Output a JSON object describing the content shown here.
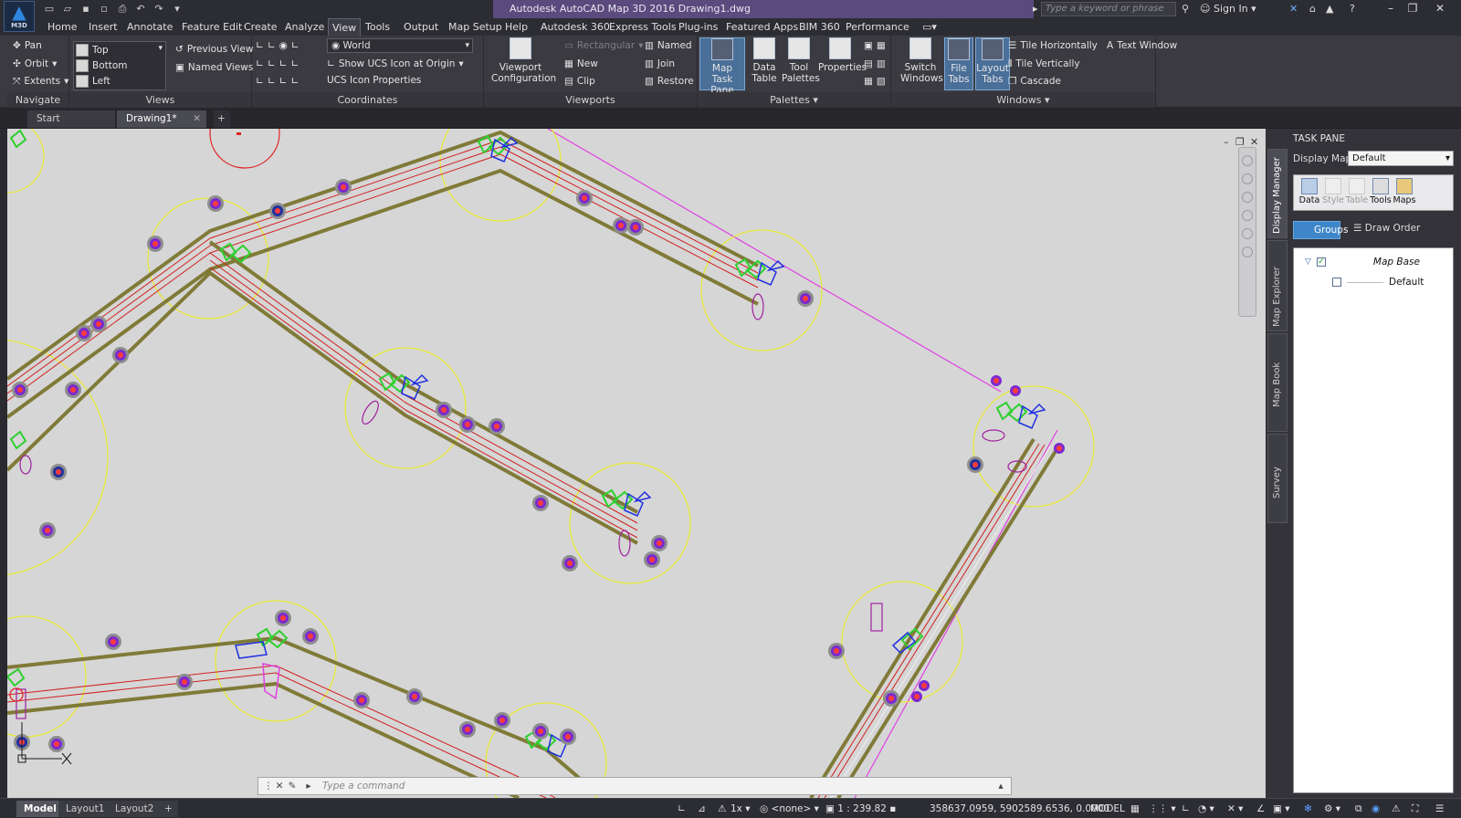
{
  "app": {
    "title": "Autodesk AutoCAD Map 3D 2016    Drawing1.dwg",
    "logo_text": "M3D",
    "search_placeholder": "Type a keyword or phrase",
    "sign_in": "Sign In"
  },
  "menu": [
    "Home",
    "Insert",
    "Annotate",
    "Feature Edit",
    "Create",
    "Analyze",
    "View",
    "Tools",
    "Output",
    "Map Setup",
    "Help",
    "Autodesk 360",
    "Express Tools",
    "Plug-ins",
    "Featured Apps",
    "BIM 360",
    "Performance"
  ],
  "menu_active": "View",
  "ribbon": {
    "navigate": {
      "title": "Navigate",
      "pan": "Pan",
      "orbit": "Orbit",
      "extents": "Extents"
    },
    "views": {
      "title": "Views",
      "top": "Top",
      "bottom": "Bottom",
      "left": "Left",
      "previous": "Previous View",
      "named": "Named Views"
    },
    "coordinates": {
      "title": "Coordinates",
      "world": "World",
      "show_ucs": "Show UCS Icon at Origin",
      "ucs_props": "UCS Icon Properties"
    },
    "viewports": {
      "title": "Viewports",
      "config": "Viewport Configuration",
      "rectangular": "Rectangular",
      "named": "Named",
      "new": "New",
      "join": "Join",
      "clip": "Clip",
      "restore": "Restore"
    },
    "palettes": {
      "title": "Palettes",
      "map_task_pane": "Map Task Pane",
      "data_table": "Data Table",
      "tool_palettes": "Tool Palettes",
      "properties": "Properties"
    },
    "windows": {
      "title": "Windows",
      "switch": "Switch Windows",
      "file_tabs": "File Tabs",
      "layout_tabs": "Layout Tabs",
      "tile_h": "Tile Horizontally",
      "tile_v": "Tile Vertically",
      "cascade": "Cascade",
      "text_window": "Text Window"
    }
  },
  "doc_tabs": [
    {
      "label": "Start"
    },
    {
      "label": "Drawing1*"
    }
  ],
  "command": {
    "placeholder": "Type  a  command"
  },
  "task_pane": {
    "title": "TASK PANE",
    "side_tabs": [
      "Display Manager",
      "Map Explorer",
      "Map Book",
      "Survey"
    ],
    "display_map_label": "Display Map:",
    "display_map_value": "Default",
    "tools": [
      {
        "label": "Data"
      },
      {
        "label": "Style"
      },
      {
        "label": "Table"
      },
      {
        "label": "Tools"
      },
      {
        "label": "Maps"
      }
    ],
    "groups": "Groups",
    "draw_order": "Draw Order",
    "tree": [
      {
        "label": "Map Base",
        "checked": true
      },
      {
        "label": "Default",
        "checked": false
      }
    ]
  },
  "status": {
    "layouts": [
      "Model",
      "Layout1",
      "Layout2"
    ],
    "scale_factor": "1x",
    "coord_system": "<none>",
    "scale": "1 : 239.82",
    "coords": "358637.0959, 5902589.6536, 0.0000",
    "space": "MODEL"
  },
  "colors": {
    "ribbon": "#3a3a40",
    "canvas": "#d6d6d6",
    "accent": "#3f86c8",
    "title_band": "#5b4a7e"
  }
}
